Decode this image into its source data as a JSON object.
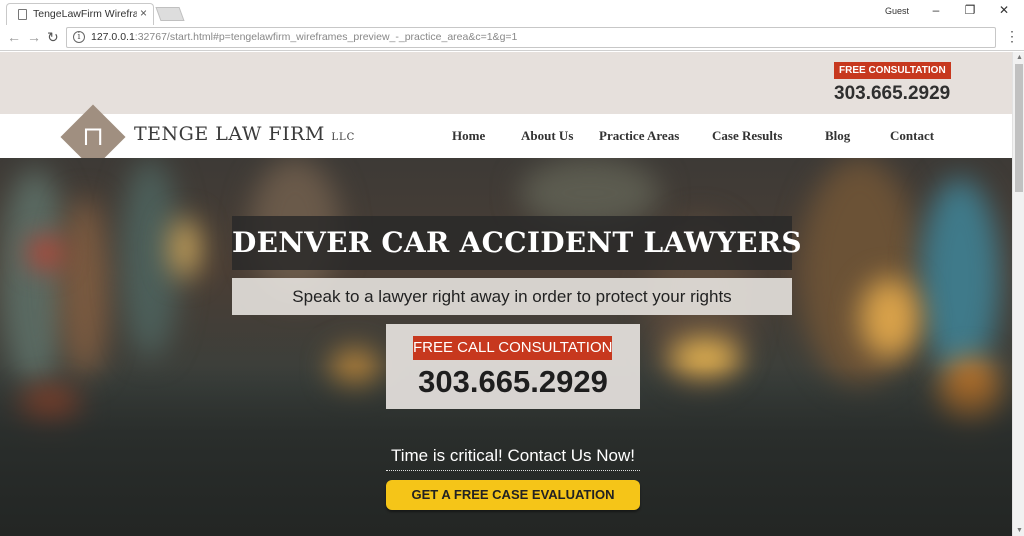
{
  "browser": {
    "tab_title": "TengeLawFirm Wireframes",
    "tab_close": "×",
    "profile": "Guest",
    "minimize": "–",
    "restore": "❐",
    "close": "✕",
    "url_host": "127.0.0.1",
    "url_rest": ":32767/start.html#p=tengelawfirm_wireframes_preview_-_practice_area&c=1&g=1",
    "back_icon": "←",
    "forward_icon": "→",
    "reload_icon": "↻",
    "info_icon": "i",
    "menu_icon": "⋮"
  },
  "header": {
    "consultation_badge": "FREE CONSULTATION",
    "phone": "303.665.2929"
  },
  "logo": {
    "glyph": "⊓",
    "name": "TENGE LAW FIRM",
    "suffix": "LLC"
  },
  "nav": {
    "items": [
      {
        "label": "Home"
      },
      {
        "label": "About Us"
      },
      {
        "label": "Practice Areas"
      },
      {
        "label": "Case Results"
      },
      {
        "label": "Blog"
      },
      {
        "label": "Contact"
      }
    ]
  },
  "hero": {
    "headline": "DENVER CAR ACCIDENT LAWYERS",
    "subheadline": "Speak to a lawyer right away in order to protect your rights",
    "call_badge": "FREE CALL CONSULTATION",
    "call_phone": "303.665.2929",
    "time_critical": "Time is critical! Contact Us Now!",
    "cta_label": "GET A FREE CASE EVALUATION"
  },
  "colors": {
    "accent_red": "#c7381e",
    "cta_yellow": "#f5c518",
    "topbar_bg": "#e6e0dc",
    "logo_brown": "#a08f80"
  }
}
